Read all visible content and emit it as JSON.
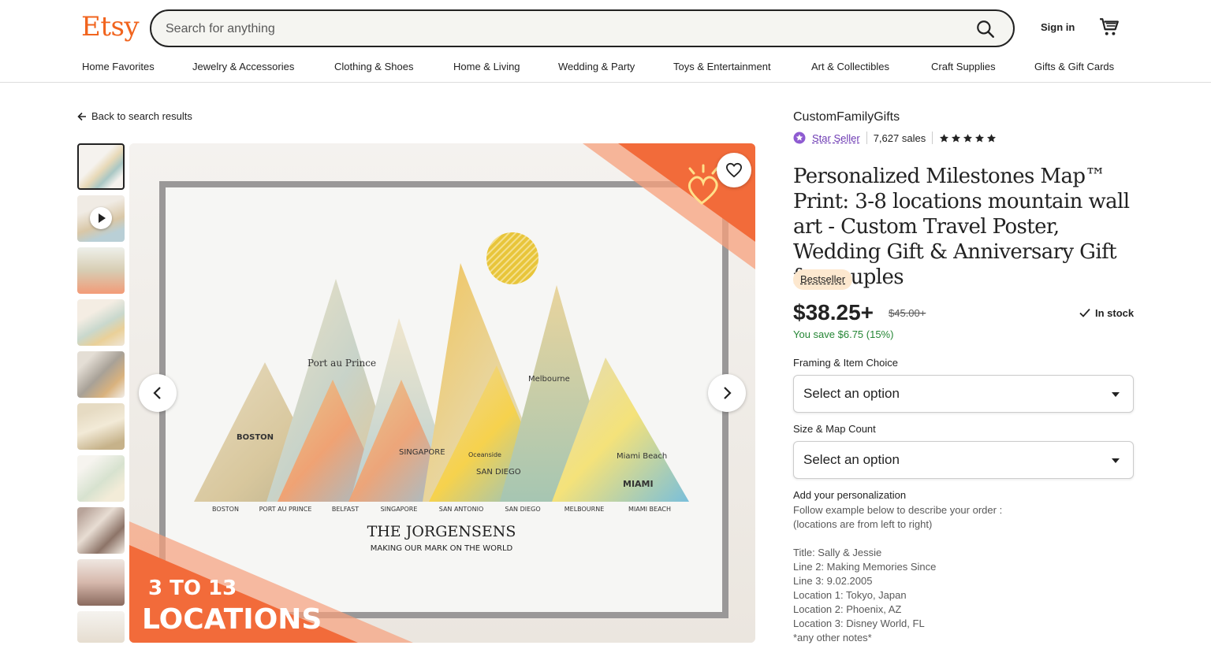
{
  "header": {
    "logo": "Etsy",
    "search_placeholder": "Search for anything",
    "sign_in": "Sign in"
  },
  "nav": {
    "items": [
      "Home Favorites",
      "Jewelry & Accessories",
      "Clothing & Shoes",
      "Home & Living",
      "Wedding & Party",
      "Toys & Entertainment",
      "Art & Collectibles",
      "Craft Supplies",
      "Gifts & Gift Cards"
    ]
  },
  "back_link": "Back to search results",
  "gallery": {
    "thumbnail_count": 10,
    "main_image": {
      "mountain_labels": [
        "BOSTON",
        "PORT AU PRINCE",
        "BELFAST",
        "SINGAPORE",
        "SAN ANTONIO",
        "SAN DIEGO",
        "MELBOURNE",
        "MIAMI BEACH"
      ],
      "family_name": "THE JORGENSENS",
      "tagline": "MAKING OUR MARK ON THE WORLD",
      "banner_line1": "3 TO 13",
      "banner_line2": "LOCATIONS",
      "map_words": [
        "Port au Prince",
        "BOSTON",
        "SINGAPORE",
        "Melbourne",
        "Miami Beach",
        "MIAMI",
        "Oceanside",
        "SAN DIEGO"
      ]
    }
  },
  "listing": {
    "shop_name": "CustomFamilyGifts",
    "star_seller": "Star Seller",
    "sales": "7,627 sales",
    "rating_stars": 5,
    "title": "Personalized Milestones Map™ Print: 3-8 locations mountain wall art - Custom Travel Poster, Wedding Gift & Anniversary Gift for couples",
    "badge": "Bestseller",
    "price": "$38.25+",
    "old_price": "$45.00+",
    "in_stock": "In stock",
    "savings": "You save $6.75 (15%)",
    "framing_label": "Framing & Item Choice",
    "framing_value": "Select an option",
    "size_label": "Size & Map Count",
    "size_value": "Select an option",
    "personalization_label": "Add your personalization",
    "personalization_lines": [
      "Follow example below to describe your order   :",
      "(locations are from left to right)",
      "",
      "Title: Sally & Jessie",
      "Line 2: Making Memories Since",
      "Line 3: 9.02.2005",
      "Location 1: Tokyo, Japan",
      "Location 2: Phoenix, AZ",
      "Location 3: Disney World, FL",
      "*any other notes*"
    ]
  },
  "colors": {
    "brand": "#f1641e",
    "star_seller": "#6d3ab3",
    "savings": "#258635",
    "badge_bg": "#fde8cf",
    "accent_banner": "#f26b3a",
    "sun": "#e8c53a"
  }
}
